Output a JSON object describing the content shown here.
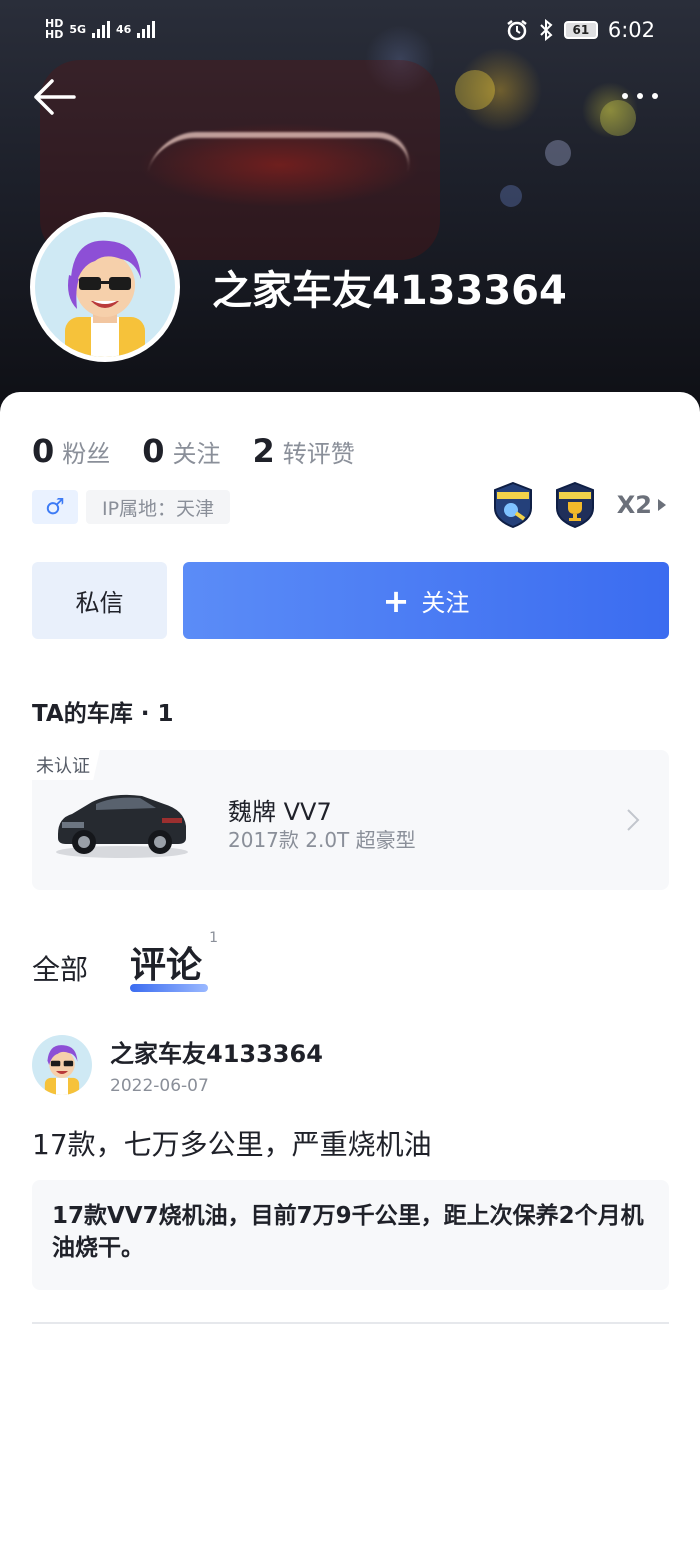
{
  "status_bar": {
    "left_labels": [
      "HD",
      "5G",
      "46"
    ],
    "time": "6:02",
    "battery": "61",
    "icons": [
      "alarm-icon",
      "bluetooth-icon",
      "battery-icon"
    ]
  },
  "header": {
    "back_icon": "back-arrow-icon",
    "more_icon": "more-dots-icon",
    "username": "之家车友4133364"
  },
  "profile": {
    "stats": [
      {
        "num": "0",
        "label": "粉丝"
      },
      {
        "num": "0",
        "label": "关注"
      },
      {
        "num": "2",
        "label": "转评赞"
      }
    ],
    "gender_symbol": "♂",
    "ip_label": "IP属地：天津",
    "badges_multiplier": "X2",
    "badge_colors": [
      "#2c4c8c",
      "#e0a82a"
    ]
  },
  "actions": {
    "message_label": "私信",
    "follow_label": "关注",
    "follow_symbol": "+"
  },
  "garage": {
    "title": "TA的车库 · 1",
    "unverified": "未认证",
    "car_name": "魏牌 VV7",
    "car_spec": "2017款 2.0T 超豪型"
  },
  "tabs": {
    "all": "全部",
    "comments": "评论",
    "comments_count": "1"
  },
  "post": {
    "author": "之家车友4133364",
    "date": "2022-06-07",
    "title": "17款，七万多公里，严重烧机油",
    "quote": "17款VV7烧机油，目前7万9千公里，距上次保养2个月机油烧干。"
  },
  "colors": {
    "accent": "#3b6cf0",
    "muted_text": "#8a8f99",
    "card_bg": "#f7f8fa"
  }
}
